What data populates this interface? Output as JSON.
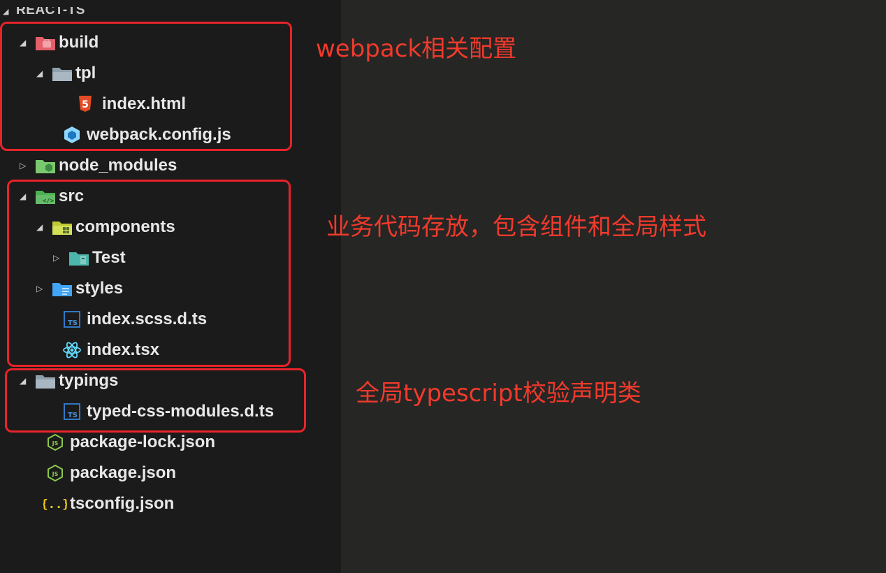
{
  "explorer": {
    "section_title": "REACT-TS",
    "items": [
      {
        "label": "build"
      },
      {
        "label": "tpl"
      },
      {
        "label": "index.html"
      },
      {
        "label": "webpack.config.js"
      },
      {
        "label": "node_modules"
      },
      {
        "label": "src"
      },
      {
        "label": "components"
      },
      {
        "label": "Test"
      },
      {
        "label": "styles"
      },
      {
        "label": "index.scss.d.ts"
      },
      {
        "label": "index.tsx"
      },
      {
        "label": "typings"
      },
      {
        "label": "typed-css-modules.d.ts"
      },
      {
        "label": "package-lock.json"
      },
      {
        "label": "package.json"
      },
      {
        "label": "tsconfig.json"
      }
    ]
  },
  "annotations": {
    "build": "webpack相关配置",
    "src": "业务代码存放，包含组件和全局样式",
    "typings": "全局typescript校验声明类"
  },
  "colors": {
    "highlight_box": "#e8232a",
    "annotation_text": "#f03a2c"
  }
}
